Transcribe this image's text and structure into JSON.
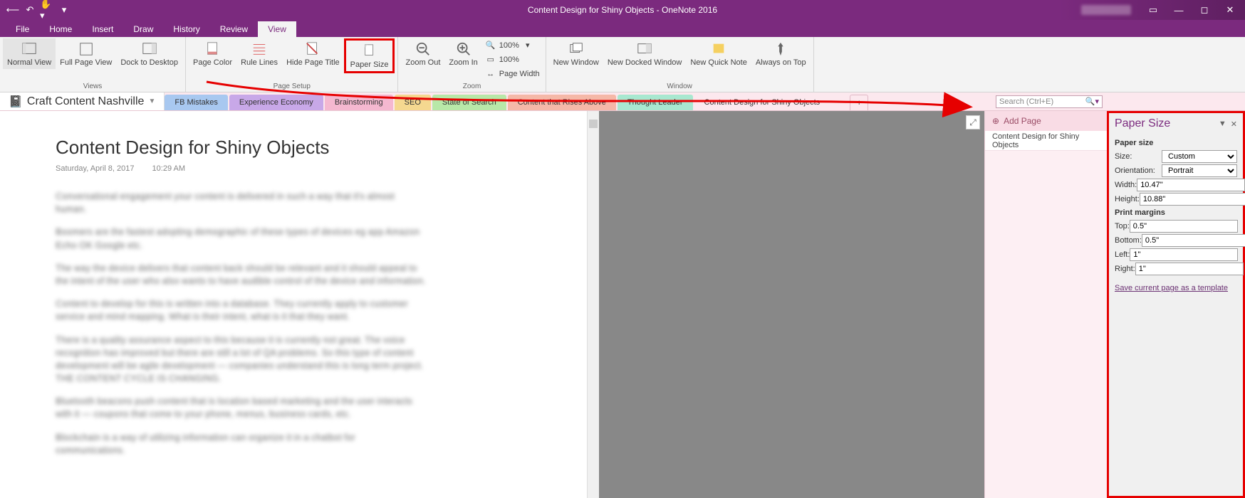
{
  "titlebar": {
    "title": "Content Design for Shiny Objects  -  OneNote 2016"
  },
  "ribbon_tabs": [
    "File",
    "Home",
    "Insert",
    "Draw",
    "History",
    "Review",
    "View"
  ],
  "active_tab_index": 6,
  "ribbon": {
    "views": {
      "normal": "Normal View",
      "fullpage": "Full Page View",
      "dock": "Dock to Desktop",
      "label": "Views"
    },
    "pagesetup": {
      "pagecolor": "Page Color",
      "rulelines": "Rule Lines",
      "hidetitle": "Hide Page Title",
      "papersize": "Paper Size",
      "label": "Page Setup"
    },
    "zoom": {
      "out": "Zoom Out",
      "in": "Zoom In",
      "p100a": "100%",
      "p100b": "100%",
      "pagewidth": "Page Width",
      "label": "Zoom"
    },
    "window": {
      "newwin": "New Window",
      "newdock": "New Docked Window",
      "newquick": "New Quick Note",
      "ontop": "Always on Top",
      "label": "Window"
    }
  },
  "notebook": {
    "name": "Craft Content Nashville"
  },
  "sections": [
    {
      "label": "FB Mistakes",
      "color": "#a8c8f0"
    },
    {
      "label": "Experience Economy",
      "color": "#c8a8e8"
    },
    {
      "label": "Brainstorming",
      "color": "#f5b8d0"
    },
    {
      "label": "SEO",
      "color": "#f5d890"
    },
    {
      "label": "State of Search",
      "color": "#b8e8a8"
    },
    {
      "label": "Content that Rises Above",
      "color": "#f5b8a8"
    },
    {
      "label": "Thought Leader",
      "color": "#a8e8d0"
    },
    {
      "label": "Content Design for Shiny Objects",
      "color": "#fce8ee",
      "active": true
    }
  ],
  "search_placeholder": "Search (Ctrl+E)",
  "pagespanel": {
    "add": "Add Page",
    "items": [
      "Content Design for Shiny Objects"
    ]
  },
  "page": {
    "title": "Content Design for Shiny Objects",
    "date": "Saturday, April 8, 2017",
    "time": "10:29 AM"
  },
  "pane": {
    "title": "Paper Size",
    "sec1": "Paper size",
    "size_label": "Size:",
    "size_val": "Custom",
    "orient_label": "Orientation:",
    "orient_val": "Portrait",
    "width_label": "Width:",
    "width_val": "10.47\"",
    "height_label": "Height:",
    "height_val": "10.88\"",
    "sec2": "Print margins",
    "top_label": "Top:",
    "top_val": "0.5\"",
    "bottom_label": "Bottom:",
    "bottom_val": "0.5\"",
    "left_label": "Left:",
    "left_val": "1\"",
    "right_label": "Right:",
    "right_val": "1\"",
    "link": "Save current page as a template"
  }
}
